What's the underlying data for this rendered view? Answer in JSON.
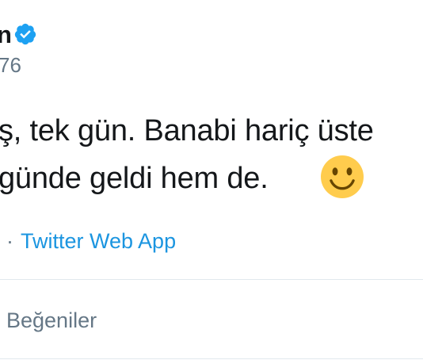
{
  "tweet": {
    "author_name_fragment": "n",
    "handle_fragment": "76",
    "verified_icon": "verified-badge-icon",
    "text_lines": [
      "ş, tek gün. Banabi hariç üste",
      "günde geldi hem de."
    ],
    "emoji": "slightly-smiling-face-icon",
    "source": {
      "separator": "·",
      "app": "Twitter Web App"
    },
    "stats": {
      "likes_label": "Beğeniler"
    }
  },
  "colors": {
    "text": "#14171a",
    "muted": "#657786",
    "link": "#1b95e0",
    "verified": "#1da1f2",
    "divider": "#e1e8ed",
    "emoji": "#ffcc4d"
  }
}
